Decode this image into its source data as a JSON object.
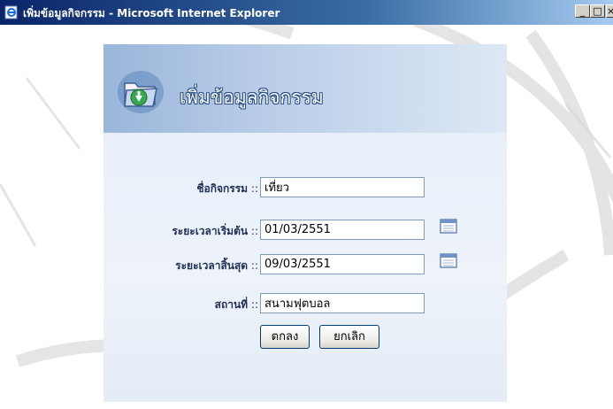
{
  "window": {
    "title": "เพิ่มข้อมูลกิจกรรม - Microsoft Internet Explorer",
    "controls": {
      "minimize": "_",
      "maximize": "□",
      "close": "×"
    }
  },
  "panel": {
    "heading": "เพิ่มข้อมูลกิจกรรม",
    "heading_icon": "folder-download-icon"
  },
  "form": {
    "separator": " ::",
    "fields": {
      "activity_name": {
        "label": "ชื่อกิจกรรม",
        "value": "เที่ยว"
      },
      "start_date": {
        "label": "ระยะเวลาเริ่มต้น",
        "value": "01/03/2551",
        "icon": "calendar-icon"
      },
      "end_date": {
        "label": "ระยะเวลาสิ้นสุด",
        "value": "09/03/2551",
        "icon": "calendar-icon"
      },
      "location": {
        "label": "สถานที่",
        "value": "สนามฟุตบอล"
      }
    },
    "buttons": {
      "ok": "ตกลง",
      "cancel": "ยกเลิก"
    }
  },
  "colors": {
    "titlebar_start": "#0a246a",
    "titlebar_end": "#a6caf0",
    "panel_bg": "#e9f0f9",
    "label_text": "#1f2f55",
    "button_border": "#003c74"
  }
}
